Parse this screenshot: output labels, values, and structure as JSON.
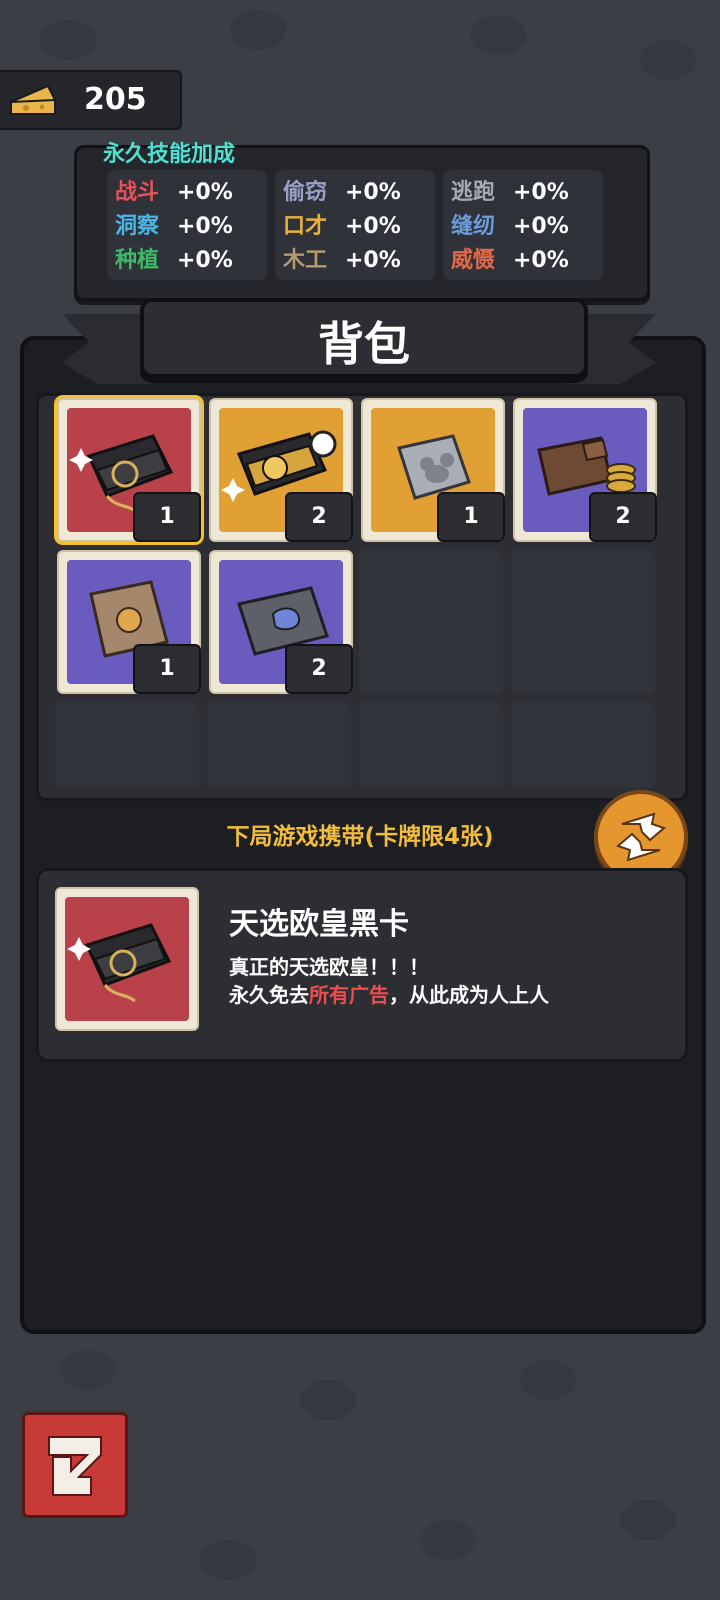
{
  "currency": {
    "icon": "cheese-icon",
    "amount": "205"
  },
  "skills": {
    "title": "永久技能加成",
    "columns": [
      [
        {
          "name": "战斗",
          "value": "+0%",
          "color": "#e5525a"
        },
        {
          "name": "洞察",
          "value": "+0%",
          "color": "#4bb6e6"
        },
        {
          "name": "种植",
          "value": "+0%",
          "color": "#3fb86a"
        }
      ],
      [
        {
          "name": "偷窃",
          "value": "+0%",
          "color": "#9aa0c8"
        },
        {
          "name": "口才",
          "value": "+0%",
          "color": "#e9b33a"
        },
        {
          "name": "木工",
          "value": "+0%",
          "color": "#b89a72"
        }
      ],
      [
        {
          "name": "逃跑",
          "value": "+0%",
          "color": "#a7aab2"
        },
        {
          "name": "缝纫",
          "value": "+0%",
          "color": "#6b9bd8"
        },
        {
          "name": "威慑",
          "value": "+0%",
          "color": "#e0694a"
        }
      ]
    ]
  },
  "backpack": {
    "title": "背包",
    "items": [
      {
        "icon": "black-card-box-icon",
        "bg": "red",
        "count": "1",
        "selected": true
      },
      {
        "icon": "gold-card-box-icon",
        "bg": "orange",
        "count": "2",
        "selected": false
      },
      {
        "icon": "silver-mouse-plate-icon",
        "bg": "orange",
        "count": "1",
        "selected": false
      },
      {
        "icon": "wallet-coins-icon",
        "bg": "purple",
        "count": "2",
        "selected": false
      },
      {
        "icon": "cloth-bag-icon",
        "bg": "purple",
        "count": "1",
        "selected": false
      },
      {
        "icon": "pencil-case-icon",
        "bg": "purple",
        "count": "2",
        "selected": false
      }
    ]
  },
  "carry": {
    "label": "下局游戏携带(卡牌限4张)"
  },
  "detail": {
    "name": "天选欧皇黑卡",
    "line1": "真正的天选欧皇！！！",
    "line2_prefix": "永久免去",
    "line2_highlight": "所有广告",
    "line2_suffix": "，从此成为人上人"
  },
  "buttons": {
    "swap": "swap-arrows-icon",
    "back": "return-arrow-icon"
  }
}
